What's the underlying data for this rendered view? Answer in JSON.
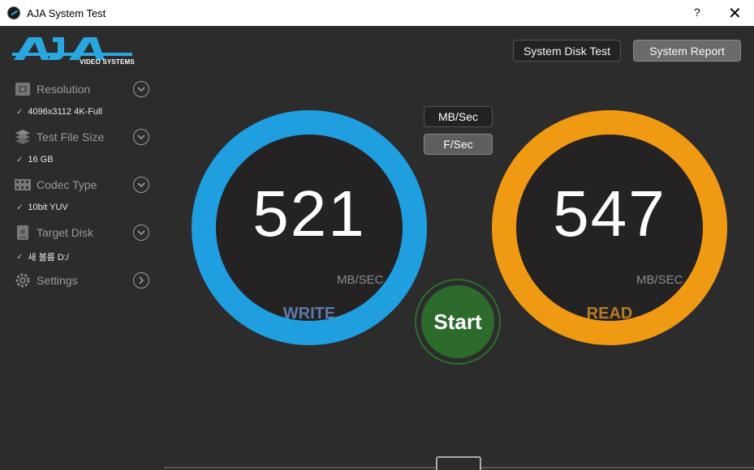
{
  "window": {
    "title": "AJA System Test",
    "help": "?",
    "close": "✕"
  },
  "logo": {
    "text": "AJA",
    "sub": "VIDEO SYSTEMS"
  },
  "sidebar": {
    "items": [
      {
        "label": "Resolution",
        "value": "4096x3112 4K-Full",
        "icon": "film-icon"
      },
      {
        "label": "Test File Size",
        "value": "16 GB",
        "icon": "layers-icon"
      },
      {
        "label": "Codec Type",
        "value": "10bit YUV",
        "icon": "filmstrip-icon"
      },
      {
        "label": "Target Disk",
        "value": "새 볼륨 D:/",
        "icon": "disk-icon"
      },
      {
        "label": "Settings",
        "icon": "gear-icon"
      }
    ],
    "check": "✓"
  },
  "toolbar": {
    "disk_test": "System Disk Test",
    "report": "System Report"
  },
  "units": {
    "mb": "MB/Sec",
    "fs": "F/Sec"
  },
  "write": {
    "value": "521",
    "unit": "MB/SEC",
    "label": "WRITE",
    "color": "#1f9ee0"
  },
  "read": {
    "value": "547",
    "unit": "MB/SEC",
    "label": "READ",
    "color": "#f09a14"
  },
  "start": {
    "label": "Start"
  }
}
